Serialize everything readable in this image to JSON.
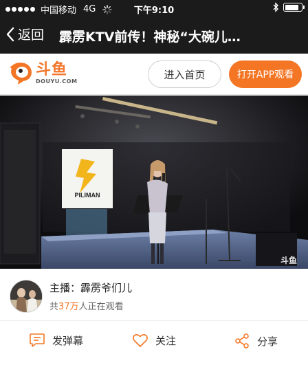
{
  "status_bar": {
    "carrier": "中国移动",
    "network": "4G",
    "time": "下午9:10",
    "battery_level": 0.85
  },
  "nav": {
    "back_label": "返回",
    "title": "霹雳KTV前传！神秘“大碗儿…"
  },
  "brand": {
    "logo_text": "斗鱼",
    "logo_url": "DOUYU.COM",
    "home_button": "进入首页",
    "open_app_button": "打开APP观看",
    "accent_color": "#f47624"
  },
  "video": {
    "poster_text": "PILIMAN",
    "watermark": "斗鱼"
  },
  "streamer": {
    "anchor_prefix": "主播：",
    "anchor_name": "霹雳爷们儿",
    "viewers_prefix": "共",
    "viewers_count": "37万",
    "viewers_suffix": "人正在观看"
  },
  "actions": {
    "danmaku_label": "发弹幕",
    "follow_label": "关注",
    "share_label": "分享"
  }
}
